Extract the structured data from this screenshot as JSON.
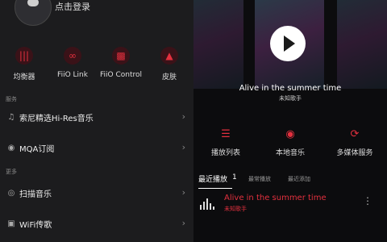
{
  "login": {
    "label": "点击登录"
  },
  "features": [
    {
      "label": "均衡器",
      "icon": "equalizer-icon"
    },
    {
      "label": "FiiO Link",
      "icon": "link-icon"
    },
    {
      "label": "FiiO Control",
      "icon": "control-icon"
    },
    {
      "label": "皮肤",
      "icon": "skin-icon"
    }
  ],
  "sections": {
    "service": "服务",
    "more": "更多"
  },
  "rows": [
    {
      "label": "索尼精选Hi-Res音乐",
      "icon": "music-note-icon"
    },
    {
      "label": "MQA订阅",
      "icon": "mqa-icon"
    },
    {
      "label": "扫描音乐",
      "icon": "scan-icon"
    },
    {
      "label": "WiFi传歌",
      "icon": "wifi-transfer-icon"
    }
  ],
  "now_playing": {
    "title": "Alive in the summer time",
    "artist": "未知歌手"
  },
  "nav": [
    {
      "label": "播放列表",
      "icon": "playlist-icon"
    },
    {
      "label": "本地音乐",
      "icon": "local-music-icon"
    },
    {
      "label": "多媒体服务",
      "icon": "media-service-icon"
    }
  ],
  "tabs": [
    {
      "label": "最近播放"
    },
    {
      "label": "1"
    },
    {
      "label": "最常播放"
    },
    {
      "label": "最近添加"
    }
  ],
  "recent": {
    "title": "Alive in the summer time",
    "artist": "未知歌手"
  },
  "colors": {
    "accent": "#e3303e"
  }
}
